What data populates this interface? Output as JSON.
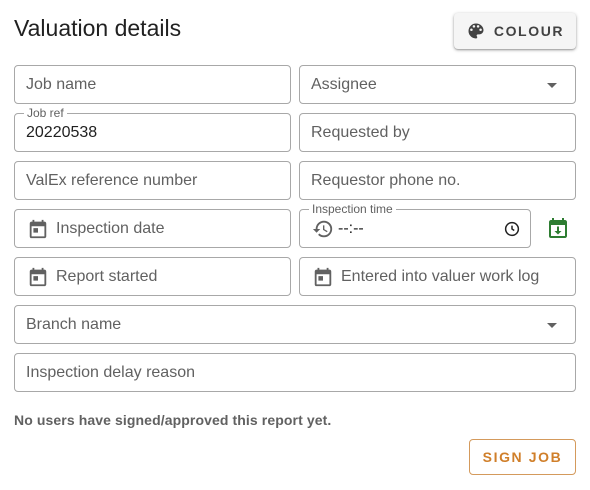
{
  "header": {
    "title": "Valuation details",
    "colour_button_label": "COLOUR",
    "colour_button_icon": "palette-icon"
  },
  "form": {
    "job_name": {
      "placeholder": "Job name"
    },
    "assignee": {
      "placeholder": "Assignee"
    },
    "job_ref": {
      "label": "Job ref",
      "value": "20220538"
    },
    "requested_by": {
      "placeholder": "Requested by"
    },
    "valex_ref": {
      "placeholder": "ValEx reference number"
    },
    "requestor_phone": {
      "placeholder": "Requestor phone no."
    },
    "inspection_date": {
      "placeholder": "Inspection date",
      "icon": "calendar-icon"
    },
    "inspection_time": {
      "label": "Inspection time",
      "value": "--:--",
      "icon": "history-icon",
      "trailing_icon": "clock-icon"
    },
    "set_today_icon": "calendar-download-icon",
    "report_started": {
      "placeholder": "Report started",
      "icon": "calendar-icon"
    },
    "entered_work_log": {
      "placeholder": "Entered into valuer work log",
      "icon": "calendar-icon"
    },
    "branch_name": {
      "placeholder": "Branch name"
    },
    "delay_reason": {
      "placeholder": "Inspection delay reason"
    }
  },
  "signoff": {
    "status": "No users have signed/approved this report yet.",
    "sign_button_label": "SIGN JOB"
  },
  "colors": {
    "accent": "#d07f2a",
    "icon_green": "#2e7d32",
    "border": "#a8a8a8"
  }
}
